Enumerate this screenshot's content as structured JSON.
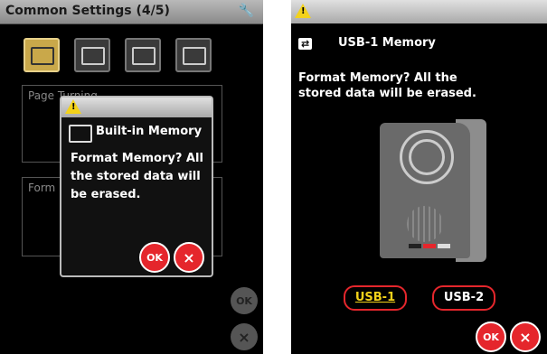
{
  "left": {
    "title": "Common Settings (4/5)",
    "bg_label_1": "Page Turning",
    "bg_label_2": "Form",
    "side_ok": "OK",
    "side_cancel": "×",
    "dialog": {
      "title": "Built-in Memory",
      "message": "Format Memory? All the stored data will be erased.",
      "ok_label": "OK",
      "cancel_label": "×"
    }
  },
  "right": {
    "device_title": "USB-1 Memory",
    "message": "Format Memory? All the stored data will be erased.",
    "usb1_label": "USB-1",
    "usb2_label": "USB-2",
    "ok_label": "OK",
    "cancel_label": "×"
  },
  "icons": {
    "warning": "warning-triangle-icon",
    "wrench": "wrench-icon",
    "usb": "usb-icon",
    "memory": "built-in-memory-icon"
  },
  "colors": {
    "accent_red": "#e5262c",
    "warning_yellow": "#f3d21a",
    "selected_text": "#f3d21a"
  }
}
